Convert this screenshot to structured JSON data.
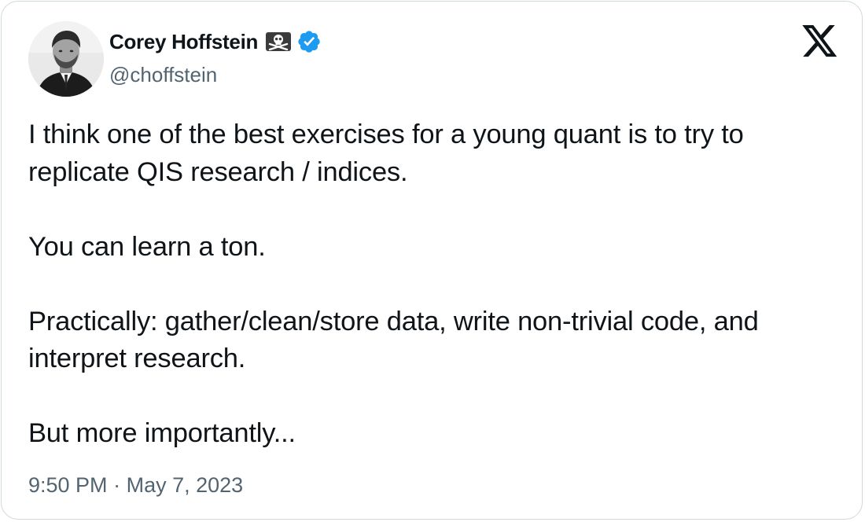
{
  "tweet": {
    "author": {
      "name": "Corey Hoffstein",
      "handle": "@choffstein",
      "name_badge": "skull-and-crossbones-icon",
      "verified": true
    },
    "paragraphs": [
      "I think one of the best exercises for a young quant is to try to replicate QIS research / indices.",
      "You can learn a ton.",
      "Practically: gather/clean/store data, write non-trivial code, and interpret research.",
      "But more importantly..."
    ],
    "time": "9:50 PM",
    "separator": "·",
    "date": "May 7, 2023"
  },
  "colors": {
    "text": "#0f1419",
    "secondary": "#536471",
    "verified": "#1d9bf0",
    "border": "#cfd9de"
  }
}
